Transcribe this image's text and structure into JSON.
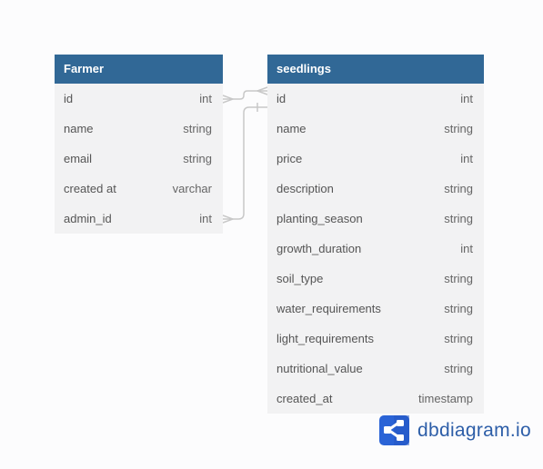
{
  "tables": [
    {
      "name": "Farmer",
      "fields": [
        {
          "name": "id",
          "type": "int"
        },
        {
          "name": "name",
          "type": "string"
        },
        {
          "name": "email",
          "type": "string"
        },
        {
          "name": "created at",
          "type": "varchar"
        },
        {
          "name": "admin_id",
          "type": "int"
        }
      ]
    },
    {
      "name": "seedlings",
      "fields": [
        {
          "name": "id",
          "type": "int"
        },
        {
          "name": "name",
          "type": "string"
        },
        {
          "name": "price",
          "type": "int"
        },
        {
          "name": "description",
          "type": "string"
        },
        {
          "name": "planting_season",
          "type": "string"
        },
        {
          "name": "growth_duration",
          "type": "int"
        },
        {
          "name": "soil_type",
          "type": "string"
        },
        {
          "name": "water_requirements",
          "type": "string"
        },
        {
          "name": "light_requirements",
          "type": "string"
        },
        {
          "name": "nutritional_value",
          "type": "string"
        },
        {
          "name": "created_at",
          "type": "timestamp"
        }
      ]
    }
  ],
  "brand": {
    "text": "dbdiagram.io",
    "color": "#2d5ea8"
  }
}
